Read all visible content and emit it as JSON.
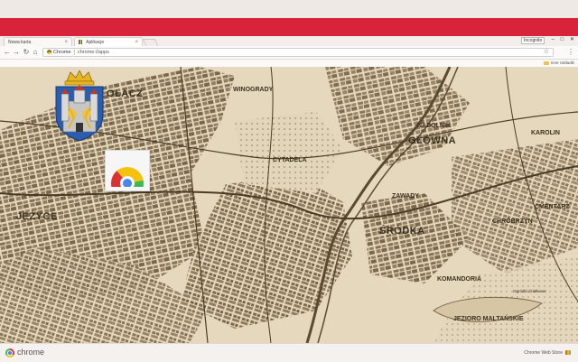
{
  "browser": {
    "tabs": [
      {
        "label": "Nowa karta",
        "active": false
      },
      {
        "label": "Aplikacje",
        "active": true
      }
    ],
    "window_user": "Incognito",
    "omnibox": {
      "chip": "Chrome",
      "url": "chrome://apps"
    },
    "bookmarks_other": "Inne zakładki"
  },
  "map": {
    "labels": [
      {
        "text": "OŁACZ",
        "size": "lg"
      },
      {
        "text": "WINOGRADY",
        "size": "md"
      },
      {
        "text": "NADOLNIK",
        "size": "md"
      },
      {
        "text": "GŁÓWNA",
        "size": "lg"
      },
      {
        "text": "KAROLIN",
        "size": "md"
      },
      {
        "text": "CYTADELA",
        "size": "md"
      },
      {
        "text": "ZAWADY",
        "size": "md"
      },
      {
        "text": "CMENTARZ",
        "size": "md"
      },
      {
        "text": "JEŻYCE",
        "size": "lg"
      },
      {
        "text": "ŚRÓDKA",
        "size": "lg"
      },
      {
        "text": "CHROBRZYN",
        "size": "md"
      },
      {
        "text": "KOMANDORIA",
        "size": "md"
      },
      {
        "text": "JEZIORO MALTAŃSKIE",
        "size": "md"
      },
      {
        "text": "Ogródki działkowe",
        "size": "sm"
      }
    ]
  },
  "footer": {
    "logo_text": "chrome",
    "store_link": "Chrome Web Store"
  },
  "colors": {
    "theme_red": "#d8233a",
    "map_paper": "#e5d7bc",
    "map_ink": "#5a4a30"
  }
}
